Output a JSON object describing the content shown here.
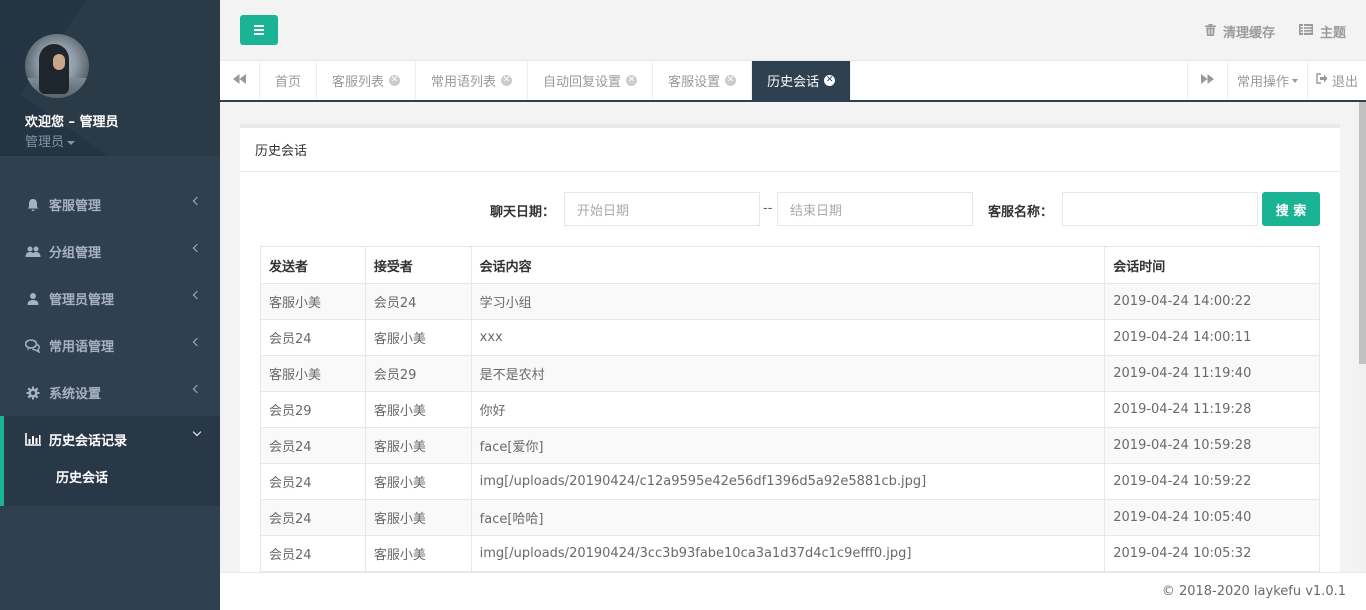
{
  "sidebar": {
    "welcome": "欢迎您 – 管理员",
    "role": "管理员",
    "items": [
      {
        "label": "客服管理",
        "icon": "bell-icon"
      },
      {
        "label": "分组管理",
        "icon": "users-icon"
      },
      {
        "label": "管理员管理",
        "icon": "user-icon"
      },
      {
        "label": "常用语管理",
        "icon": "comments-icon"
      },
      {
        "label": "系统设置",
        "icon": "gear-icon"
      }
    ],
    "active_group": {
      "label": "历史会话记录",
      "icon": "bar-chart-icon"
    },
    "active_sub": "历史会话"
  },
  "header": {
    "clear_cache": "清理缓存",
    "theme": "主题"
  },
  "tabs": {
    "items": [
      "首页",
      "客服列表",
      "常用语列表",
      "自动回复设置",
      "客服设置",
      "历史会话"
    ],
    "common_ops": "常用操作",
    "logout": "退出"
  },
  "panel": {
    "title": "历史会话"
  },
  "search": {
    "date_label": "聊天日期：",
    "start_placeholder": "开始日期",
    "separator": "--",
    "end_placeholder": "结束日期",
    "name_label": "客服名称：",
    "button": "搜 索"
  },
  "table": {
    "headers": [
      "发送者",
      "接受者",
      "会话内容",
      "会话时间"
    ],
    "rows": [
      [
        "客服小美",
        "会员24",
        "学习小组",
        "2019-04-24 14:00:22"
      ],
      [
        "会员24",
        "客服小美",
        "xxx",
        "2019-04-24 14:00:11"
      ],
      [
        "客服小美",
        "会员29",
        "是不是农村",
        "2019-04-24 11:19:40"
      ],
      [
        "会员29",
        "客服小美",
        "你好",
        "2019-04-24 11:19:28"
      ],
      [
        "会员24",
        "客服小美",
        "face[爱你]",
        "2019-04-24 10:59:28"
      ],
      [
        "会员24",
        "客服小美",
        "img[/uploads/20190424/c12a9595e42e56df1396d5a92e5881cb.jpg]",
        "2019-04-24 10:59:22"
      ],
      [
        "会员24",
        "客服小美",
        "face[哈哈]",
        "2019-04-24 10:05:40"
      ],
      [
        "会员24",
        "客服小美",
        "img[/uploads/20190424/3cc3b93fabe10ca3a1d37d4c1c9efff0.jpg]",
        "2019-04-24 10:05:32"
      ]
    ]
  },
  "footer": "© 2018-2020 laykefu v1.0.1",
  "colors": {
    "accent": "#1ab394",
    "sidebar": "#2f4050"
  }
}
